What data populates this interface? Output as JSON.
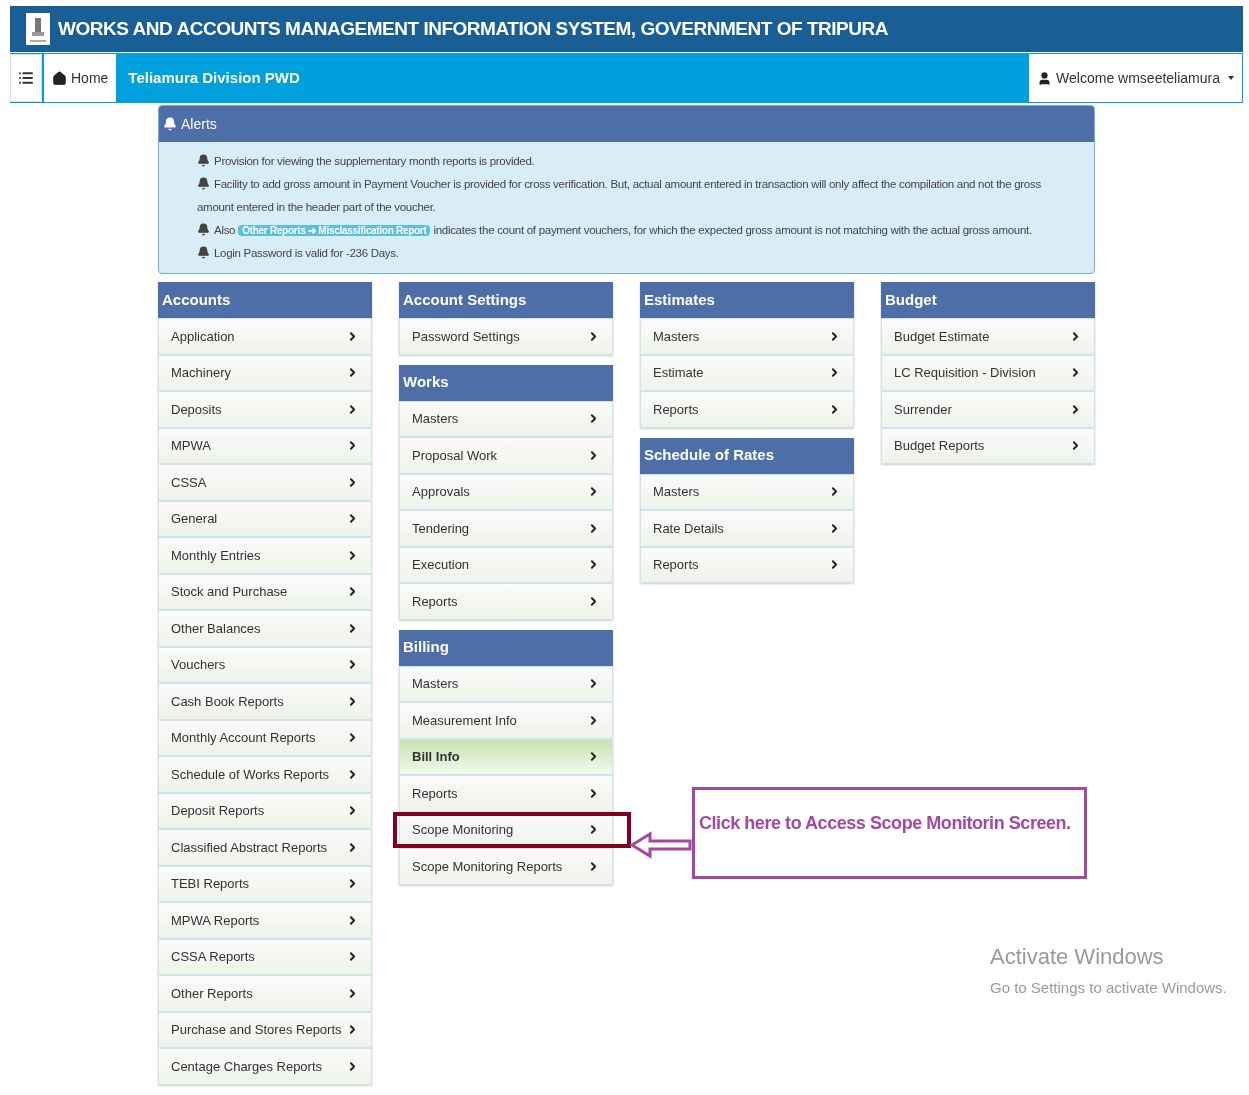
{
  "header": {
    "title": "WORKS AND ACCOUNTS MANAGEMENT INFORMATION SYSTEM, GOVERNMENT OF TRIPURA"
  },
  "navbar": {
    "home": "Home",
    "division": "Teliamura Division PWD",
    "user": "Welcome wmseeteliamura"
  },
  "alerts": {
    "title": "Alerts",
    "messages": [
      {
        "text": "Provision for viewing the supplementary month reports is provided."
      },
      {
        "text": "Facility to add gross amount in Payment Voucher is provided for cross verification. But, actual amount entered in transaction will only affect the compilation and not the gross amount entered in the header part of the voucher."
      },
      {
        "text": "Also",
        "badge": "Other Reports ➔ Misclassification Report",
        "text_after": "indicates the count of payment vouchers, for which the expected gross amount is not matching with the actual gross amount."
      },
      {
        "text": "Login Password is valid for -236 Days."
      }
    ]
  },
  "columns": [
    [
      {
        "title": "Accounts",
        "items": [
          {
            "label": "Application",
            "selected": false
          },
          {
            "label": "Machinery",
            "selected": false
          },
          {
            "label": "Deposits",
            "selected": false
          },
          {
            "label": "MPWA",
            "selected": false
          },
          {
            "label": "CSSA",
            "selected": false
          },
          {
            "label": "General",
            "selected": false
          },
          {
            "label": "Monthly Entries",
            "selected": false
          },
          {
            "label": "Stock and Purchase",
            "selected": false
          },
          {
            "label": "Other Balances",
            "selected": false
          },
          {
            "label": "Vouchers",
            "selected": false
          },
          {
            "label": "Cash Book Reports",
            "selected": false
          },
          {
            "label": "Monthly Account Reports",
            "selected": false
          },
          {
            "label": "Schedule of Works Reports",
            "selected": false
          },
          {
            "label": "Deposit Reports",
            "selected": false
          },
          {
            "label": "Classified Abstract Reports",
            "selected": false
          },
          {
            "label": "TEBI Reports",
            "selected": false
          },
          {
            "label": "MPWA Reports",
            "selected": false
          },
          {
            "label": "CSSA Reports",
            "selected": false
          },
          {
            "label": "Other Reports",
            "selected": false
          },
          {
            "label": "Purchase and Stores Reports",
            "selected": false
          },
          {
            "label": "Centage Charges Reports",
            "selected": false
          }
        ]
      }
    ],
    [
      {
        "title": "Account Settings",
        "items": [
          {
            "label": "Password Settings",
            "selected": false
          }
        ]
      },
      {
        "title": "Works",
        "items": [
          {
            "label": "Masters",
            "selected": false
          },
          {
            "label": "Proposal Work",
            "selected": false
          },
          {
            "label": "Approvals",
            "selected": false
          },
          {
            "label": "Tendering",
            "selected": false
          },
          {
            "label": "Execution",
            "selected": false
          },
          {
            "label": "Reports",
            "selected": false
          }
        ]
      },
      {
        "title": "Billing",
        "items": [
          {
            "label": "Masters",
            "selected": false,
            "boxed": false
          },
          {
            "label": "Measurement Info",
            "selected": false,
            "boxed": false
          },
          {
            "label": "Bill Info",
            "selected": true,
            "boxed": false
          },
          {
            "label": "Reports",
            "selected": false,
            "boxed": false
          },
          {
            "label": "Scope Monitoring",
            "selected": false,
            "boxed": true
          },
          {
            "label": "Scope Monitoring Reports",
            "selected": false,
            "boxed": false
          }
        ]
      }
    ],
    [
      {
        "title": "Estimates",
        "items": [
          {
            "label": "Masters",
            "selected": false
          },
          {
            "label": "Estimate",
            "selected": false
          },
          {
            "label": "Reports",
            "selected": false
          }
        ]
      },
      {
        "title": "Schedule of Rates",
        "items": [
          {
            "label": "Masters",
            "selected": false
          },
          {
            "label": "Rate Details",
            "selected": false
          },
          {
            "label": "Reports",
            "selected": false
          }
        ]
      }
    ],
    [
      {
        "title": "Budget",
        "items": [
          {
            "label": "Budget Estimate",
            "selected": false
          },
          {
            "label": "LC Requisition - Division",
            "selected": false
          },
          {
            "label": "Surrender",
            "selected": false
          },
          {
            "label": "Budget Reports",
            "selected": false
          }
        ]
      }
    ]
  ],
  "callout": {
    "text": "Click here to Access Scope Monitorin Screen."
  },
  "os_notice": {
    "title": "Activate Windows",
    "subtitle": "Go to Settings to activate Windows."
  }
}
